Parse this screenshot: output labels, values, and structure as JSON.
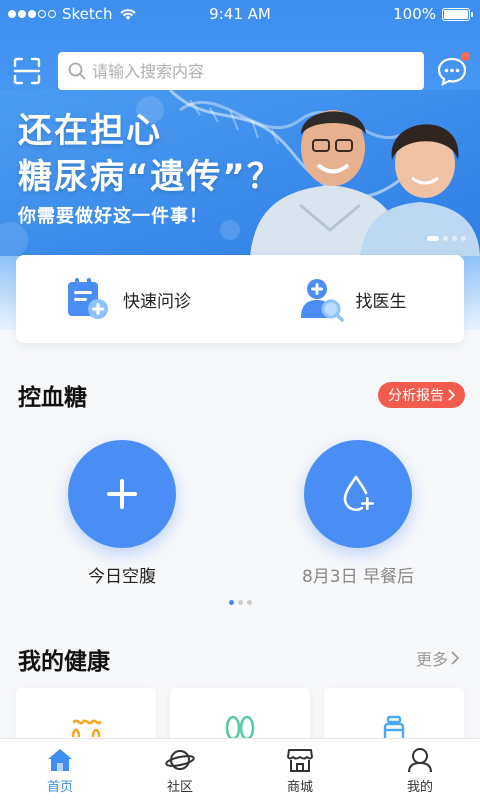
{
  "status_bar": {
    "carrier": "Sketch",
    "time": "9:41 AM",
    "battery": "100%"
  },
  "header": {
    "search_placeholder": "请输入搜索内容",
    "scan_icon": "scan-icon",
    "message_icon": "chat-bubble-icon",
    "message_badge": true
  },
  "banner": {
    "line1": "还在担心",
    "line2": "糖尿病“遗传”？",
    "line3": "你需要做好这一件事！"
  },
  "quick_actions": [
    {
      "label": "快速问诊",
      "icon": "clipboard-plus-icon"
    },
    {
      "label": "找医生",
      "icon": "doctor-search-icon"
    }
  ],
  "blood_sugar": {
    "title": "控血糖",
    "report_label": "分析报告",
    "actions": [
      {
        "label": "今日空腹",
        "icon": "plus-icon"
      },
      {
        "label": "8月3日 早餐后",
        "icon": "drop-plus-icon"
      }
    ]
  },
  "health": {
    "title": "我的健康",
    "more_label": "更多"
  },
  "tabs": [
    {
      "label": "首页",
      "icon": "home-icon",
      "active": true
    },
    {
      "label": "社区",
      "icon": "planet-icon",
      "active": false
    },
    {
      "label": "商城",
      "icon": "store-icon",
      "active": false
    },
    {
      "label": "我的",
      "icon": "user-icon",
      "active": false
    }
  ],
  "colors": {
    "primary": "#3d8ef0",
    "accent_red": "#f25b4d",
    "circle_blue": "#4a8ef5"
  }
}
